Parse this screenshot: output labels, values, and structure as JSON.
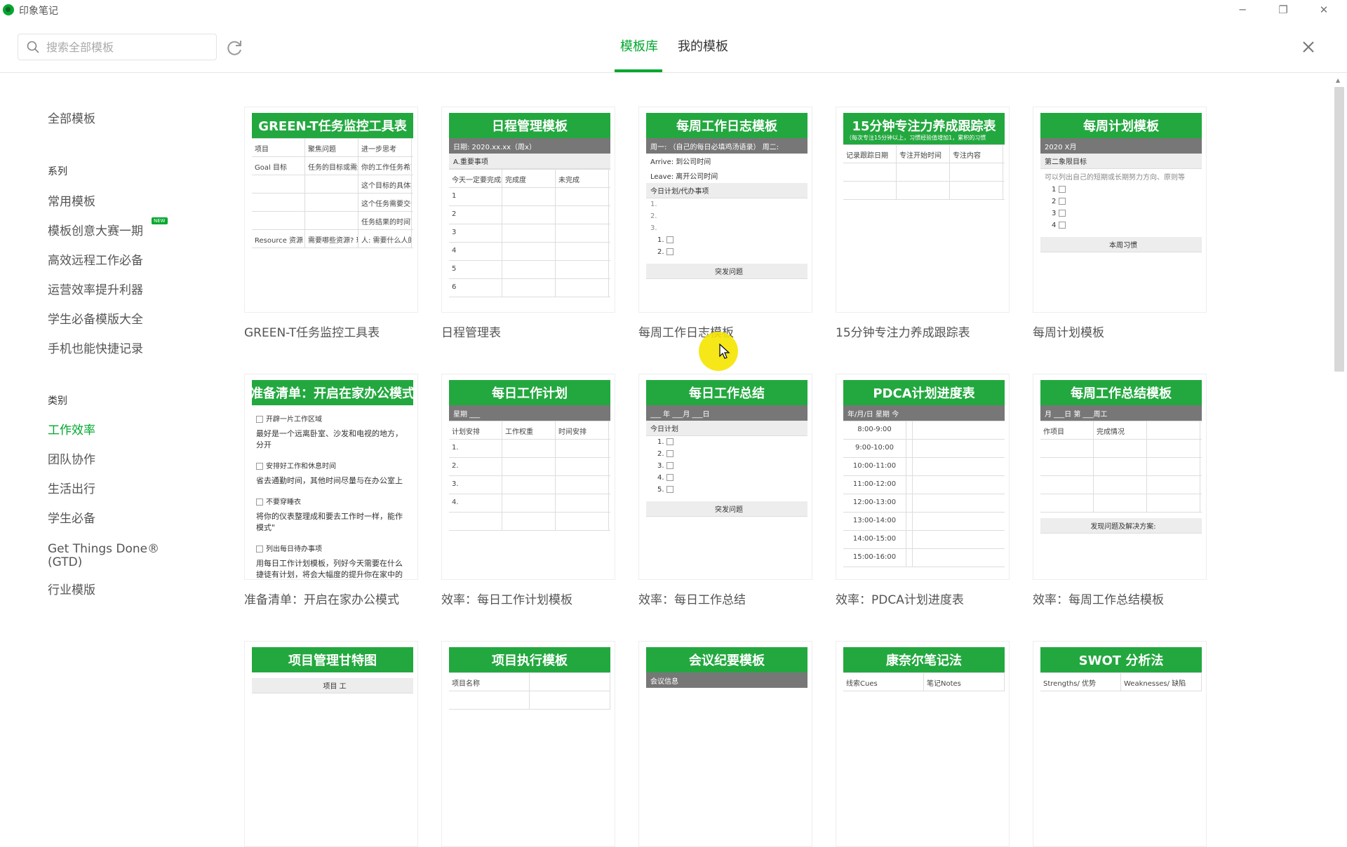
{
  "app": {
    "title": "印象笔记",
    "colors": {
      "accent": "#00a82d",
      "header_green": "#23a83f"
    }
  },
  "window_controls": {
    "minimize": "─",
    "restore": "❐",
    "close": "✕"
  },
  "header": {
    "search_placeholder": "搜索全部模板",
    "tabs": [
      {
        "label": "模板库",
        "active": true
      },
      {
        "label": "我的模板",
        "active": false
      }
    ]
  },
  "sidebar": {
    "all": "全部模板",
    "series_heading": "系列",
    "series": [
      "常用模板",
      "模板创意大赛一期",
      "高效远程工作必备",
      "运营效率提升利器",
      "学生必备模版大全",
      "手机也能快捷记录"
    ],
    "new_badge": "NEW",
    "category_heading": "类别",
    "categories": [
      "工作效率",
      "团队协作",
      "生活出行",
      "学生必备",
      "Get Things Done® (GTD)",
      "行业模版"
    ],
    "active_category": "工作效率"
  },
  "cards": [
    {
      "label": "GREEN-T任务监控工具表",
      "header": "GREEN-T任务监控工具表",
      "rows": [
        [
          "项目",
          "聚焦问题",
          "进一步思考"
        ],
        [
          "Goal 目标",
          "任务的目标或需达成的结果是什么?",
          "你的工作任务希望达成是?"
        ],
        [
          "",
          "",
          "这个目标的具体指标是(怎样算达标? 衡量工是?)"
        ],
        [
          "",
          "",
          "这个任务需要交付给谁(是否有特别要求?)"
        ],
        [
          "",
          "",
          "任务结果的时间节点是"
        ],
        [
          "Resource 资源",
          "需要哪些资源? 现在有哪些资源?",
          "人: 需要什么人的支持的参与?"
        ]
      ]
    },
    {
      "label": "日程管理表",
      "header": "日程管理模板",
      "sub": "日期: 2020.xx.xx（周x）",
      "sub2": "A.重要事项",
      "rows": [
        [
          "今天一定要完成的几件事",
          "完成度",
          "未完成"
        ],
        [
          "1",
          "",
          ""
        ],
        [
          "2",
          "",
          ""
        ],
        [
          "3",
          "",
          ""
        ],
        [
          "4",
          "",
          ""
        ],
        [
          "5",
          "",
          ""
        ],
        [
          "6",
          "",
          ""
        ]
      ]
    },
    {
      "label": "每周工作日志模板",
      "header": "每周工作日志模板",
      "lines": [
        "1.",
        "2.",
        "3."
      ],
      "sub": "周一: （自己的每日必填鸡汤语录）   周二:",
      "lines2": [
        "Arrive: 到公司时间",
        "Leave: 离开公司时间"
      ],
      "sub2": "今日计划/代办事项",
      "checks": [
        "1.",
        "2."
      ],
      "footer": "突发问题"
    },
    {
      "label": "15分钟专注力养成跟踪表",
      "header": "15分钟专注力养成跟踪表",
      "note": "（每次专注15分钟以上，习惯经验值增加1，累积的习惯",
      "rows": [
        [
          "记录跟踪日期",
          "专注开始时间",
          "专注内容"
        ],
        [
          "",
          "",
          ""
        ],
        [
          "",
          "",
          ""
        ]
      ]
    },
    {
      "label": "每周计划模板",
      "header": "每周计划模板",
      "sub": "2020 X月",
      "sub2": "第二象限目标",
      "lines": [
        "可以列出自己的短期或长期努力方向、原则等"
      ],
      "checks": [
        "1",
        "2",
        "3",
        "4"
      ],
      "footer": "本周习惯"
    },
    {
      "label": "准备清单：开启在家办公模式",
      "header": "准备清单：开启在家办公模式",
      "items": [
        [
          "开辟一片工作区域",
          "最好是一个远离卧室、沙发和电视的地方，分开"
        ],
        [
          "安排好工作和休息时间",
          "省去通勤时间，其他时间尽量与在办公室上"
        ],
        [
          "不要穿睡衣",
          "将你的仪表整理成和要去工作时一样，能作模式\""
        ],
        [
          "列出每日待办事项",
          "用每日工作计划模板，列好今天需要在什么捷徒有计划，将会大幅度的提升你在家中的"
        ]
      ]
    },
    {
      "label": "效率：每日工作计划模板",
      "header": "每日工作计划",
      "sub": "星期 ___",
      "rows": [
        [
          "计划安排",
          "工作权重",
          "时间安排"
        ],
        [
          "1.",
          "",
          ""
        ],
        [
          "2.",
          "",
          ""
        ],
        [
          "3.",
          "",
          ""
        ],
        [
          "4.",
          "",
          ""
        ],
        [
          "",
          "",
          ""
        ]
      ]
    },
    {
      "label": "效率：每日工作总结",
      "header": "每日工作总结",
      "sub": "___ 年 ___月 ___日",
      "sub2": "今日计划",
      "checks": [
        "1.",
        "2.",
        "3.",
        "4.",
        "5."
      ],
      "footer": "突发问题"
    },
    {
      "label": "效率：PDCA计划进度表",
      "header": "PDCA计划进度表",
      "sub": "年/月/日  星期                                   今",
      "times": [
        "8:00-9:00",
        "9:00-10:00",
        "10:00-11:00",
        "11:00-12:00",
        "12:00-13:00",
        "13:00-14:00",
        "14:00-15:00",
        "15:00-16:00"
      ]
    },
    {
      "label": "效率：每周工作总结模板",
      "header": "每周工作总结模板",
      "sub": "月 ___日                             第 ___周工",
      "rows": [
        [
          "作项目",
          "完成情况",
          ""
        ],
        [
          "",
          "",
          ""
        ],
        [
          "",
          "",
          ""
        ],
        [
          "",
          "",
          ""
        ],
        [
          "",
          "",
          ""
        ]
      ],
      "footer": "发现问题及解决方案:"
    },
    {
      "label": "",
      "header": "项目管理甘特图",
      "footer": "项目 工"
    },
    {
      "label": "",
      "header": "项目执行模板",
      "rows": [
        [
          "项目名称",
          ""
        ],
        [
          "",
          ""
        ]
      ]
    },
    {
      "label": "",
      "header": "会议纪要模板",
      "sub": "会议信息"
    },
    {
      "label": "",
      "header": "康奈尔笔记法",
      "rows": [
        [
          "线索Cues",
          "笔记Notes"
        ]
      ]
    },
    {
      "label": "",
      "header": "SWOT 分析法",
      "rows": [
        [
          "Strengths/ 优势",
          "Weaknesses/ 缺陷"
        ]
      ]
    }
  ]
}
